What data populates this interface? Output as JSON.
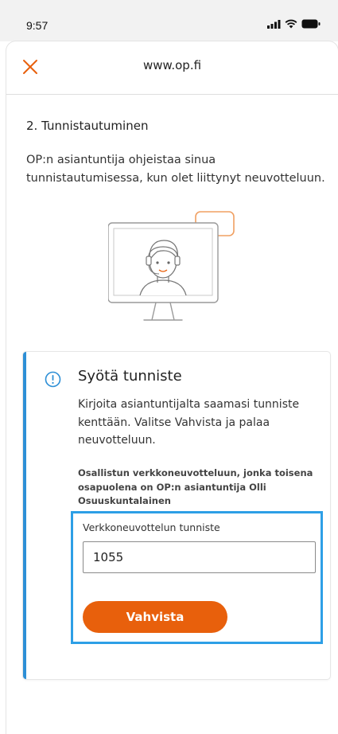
{
  "status_bar": {
    "time": "9:57",
    "signal_icon": "signal-icon",
    "wifi_icon": "wifi-icon",
    "battery_icon": "battery-icon"
  },
  "browser": {
    "url": "www.op.fi",
    "close_icon": "close-icon"
  },
  "step": {
    "heading": "2. Tunnistautuminen",
    "intro": "OP:n asiantuntija ohjeistaa sinua tunnistautumisessa, kun olet liittynyt neuvotteluun.",
    "illustration": "advisor-on-monitor-illustration"
  },
  "card": {
    "icon": "info-icon",
    "title": "Syötä tunniste",
    "description": "Kirjoita asiantuntijalta saamasi tunniste kenttään. Valitse Vahvista ja palaa neuvotteluun.",
    "note": "Osallistun verkkoneuvotteluun, jonka toisena osapuolena on OP:n asiantuntija Olli Osuuskuntalainen",
    "field_label": "Verkkoneuvottelun tunniste",
    "field_value": "1055",
    "confirm_label": "Vahvista"
  },
  "colors": {
    "accent_orange": "#e8600c",
    "info_blue": "#2d8fd6",
    "focus_blue": "#2d9fe6"
  }
}
